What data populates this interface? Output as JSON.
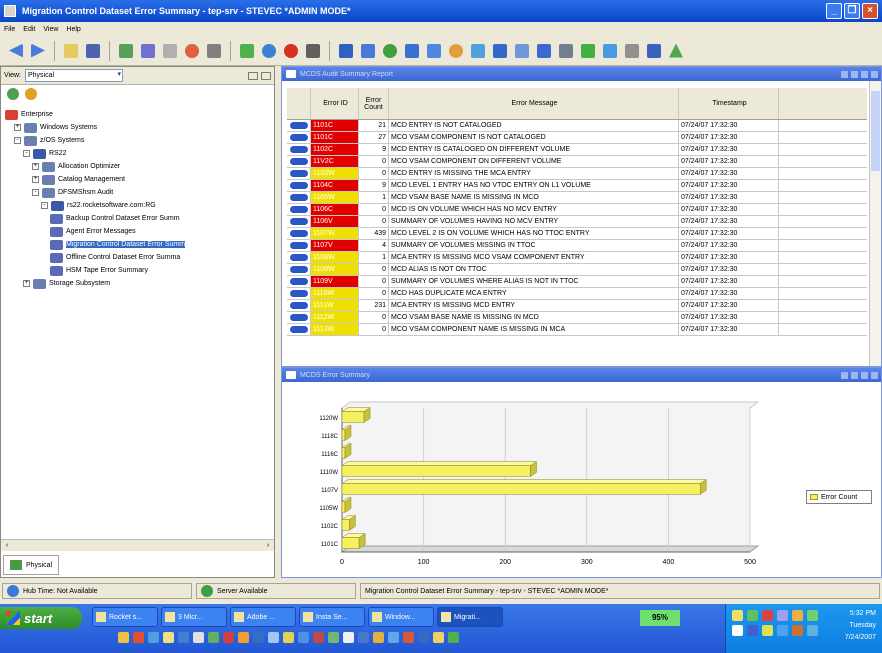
{
  "window": {
    "title": "Migration Control Dataset Error Summary - tep-srv - STEVEC   *ADMIN MODE*"
  },
  "menu": [
    "File",
    "Edit",
    "View",
    "Help"
  ],
  "left_pane": {
    "view_label": "View:",
    "view_value": "Physical",
    "tree": [
      {
        "label": "Enterprise",
        "level": 0,
        "expander": "",
        "icon": "enterprise"
      },
      {
        "label": "Windows Systems",
        "level": 1,
        "expander": "+",
        "icon": "folder"
      },
      {
        "label": "z/OS Systems",
        "level": 1,
        "expander": "-",
        "icon": "folder"
      },
      {
        "label": "RS22",
        "level": 2,
        "expander": "-",
        "icon": "system"
      },
      {
        "label": "Allocation Optimizer",
        "level": 3,
        "expander": "+",
        "icon": "folder"
      },
      {
        "label": "Catalog Management",
        "level": 3,
        "expander": "+",
        "icon": "folder"
      },
      {
        "label": "DFSMShsm Audit",
        "level": 3,
        "expander": "-",
        "icon": "folder"
      },
      {
        "label": "rs22.rocketsoftware.com:RG",
        "level": 4,
        "expander": "-",
        "icon": "system"
      },
      {
        "label": "Backup Control Dataset Error Summ",
        "level": 5,
        "expander": "",
        "icon": "report"
      },
      {
        "label": "Agent Error Messages",
        "level": 5,
        "expander": "",
        "icon": "report"
      },
      {
        "label": "Migration Control Dataset Error Summ",
        "level": 5,
        "expander": "",
        "icon": "report",
        "selected": true
      },
      {
        "label": "Offline Control Dataset Error Summa",
        "level": 5,
        "expander": "",
        "icon": "report"
      },
      {
        "label": "HSM Tape Error Summary",
        "level": 5,
        "expander": "",
        "icon": "report"
      },
      {
        "label": "Storage Subsystem",
        "level": 2,
        "expander": "+",
        "icon": "folder"
      }
    ],
    "tab_label": "Physical"
  },
  "report_panel": {
    "title": "MCDS Audit Summary Report",
    "columns": [
      "Error ID",
      "Error Count",
      "Error Message",
      "Timestamp"
    ],
    "rows": [
      {
        "id": "1101C",
        "count": "21",
        "message": "MCD ENTRY IS NOT CATALOGED",
        "ts": "07/24/07 17:32:30",
        "sev": "red"
      },
      {
        "id": "1101C",
        "count": "27",
        "message": "MCO VSAM COMPONENT IS NOT CATALOGED",
        "ts": "07/24/07 17:32:30",
        "sev": "red"
      },
      {
        "id": "1102C",
        "count": "9",
        "message": "MCD ENTRY IS CATALOGED ON DIFFERENT VOLUME",
        "ts": "07/24/07 17:32:30",
        "sev": "red"
      },
      {
        "id": "11V2C",
        "count": "0",
        "message": "MCO VSAM COMPONENT ON DIFFERENT VOLUME",
        "ts": "07/24/07 17:32:30",
        "sev": "red"
      },
      {
        "id": "1103W",
        "count": "0",
        "message": "MCD ENTRY IS MISSING THE MCA ENTRY",
        "ts": "07/24/07 17:32:30",
        "sev": "yellow"
      },
      {
        "id": "1104C",
        "count": "9",
        "message": "MCD LEVEL 1 ENTRY HAS NO VTOC ENTRY ON L1 VOLUME",
        "ts": "07/24/07 17:32:30",
        "sev": "red"
      },
      {
        "id": "1105W",
        "count": "1",
        "message": "MCD VSAM BASE NAME IS MISSING IN MCO",
        "ts": "07/24/07 17:32:30",
        "sev": "yellow"
      },
      {
        "id": "1106C",
        "count": "0",
        "message": "MCD IS ON VOLUME WHICH HAS NO MCV ENTRY",
        "ts": "07/24/07 17:32:30",
        "sev": "red"
      },
      {
        "id": "1106V",
        "count": "0",
        "message": "SUMMARY OF VOLUMES HAVING NO MCV ENTRY",
        "ts": "07/24/07 17:32:30",
        "sev": "red"
      },
      {
        "id": "1107W",
        "count": "439",
        "message": "MCD LEVEL 2 IS ON VOLUME WHICH HAS NO TTOC ENTRY",
        "ts": "07/24/07 17:32:30",
        "sev": "yellow"
      },
      {
        "id": "1107V",
        "count": "4",
        "message": "SUMMARY OF VOLUMES MISSING IN TTOC",
        "ts": "07/24/07 17:32:30",
        "sev": "red"
      },
      {
        "id": "1108W",
        "count": "1",
        "message": "MCA ENTRY IS MISSING MCO VSAM COMPONENT ENTRY",
        "ts": "07/24/07 17:32:30",
        "sev": "yellow"
      },
      {
        "id": "1109W",
        "count": "0",
        "message": "MCD ALIAS IS NOT ON TTOC",
        "ts": "07/24/07 17:32:30",
        "sev": "yellow"
      },
      {
        "id": "1109V",
        "count": "0",
        "message": "SUMMARY OF VOLUMES WHERE ALIAS IS NOT IN TTOC",
        "ts": "07/24/07 17:32:30",
        "sev": "red"
      },
      {
        "id": "1110W",
        "count": "0",
        "message": "MCD HAS DUPLICATE MCA ENTRY",
        "ts": "07/24/07 17:32:30",
        "sev": "yellow"
      },
      {
        "id": "1111W",
        "count": "231",
        "message": "MCA ENTRY IS MISSING MCD ENTRY",
        "ts": "07/24/07 17:32:30",
        "sev": "yellow"
      },
      {
        "id": "1112W",
        "count": "0",
        "message": "MCO VSAM BASE NAME IS MISSING IN MCD",
        "ts": "07/24/07 17:32:30",
        "sev": "yellow"
      },
      {
        "id": "1113W",
        "count": "0",
        "message": "MCO VSAM COMPONENT NAME IS MISSING IN MCA",
        "ts": "07/24/07 17:32:30",
        "sev": "yellow"
      }
    ]
  },
  "chart_panel": {
    "title": "MCDS Error Summary"
  },
  "chart_data": {
    "type": "bar",
    "orientation": "horizontal",
    "categories": [
      "1101C",
      "1102C",
      "1105W",
      "1107V",
      "1110W",
      "1116C",
      "1118C",
      "1120W"
    ],
    "series": [
      {
        "name": "Error Count",
        "values": [
          21,
          9,
          1,
          439,
          231,
          0,
          0,
          27
        ]
      }
    ],
    "xlim": [
      0,
      500
    ],
    "xticks": [
      0,
      100,
      200,
      300,
      400,
      500
    ],
    "grid": true,
    "legend": "right",
    "bar_color": "#f4f060"
  },
  "status": {
    "hub": "Hub Time: Not Available",
    "server": "Server Available",
    "workspace": "Migration Control Dataset Error Summary - tep-srv - STEVEC   *ADMIN MODE*"
  },
  "taskbar": {
    "start": "start",
    "tasks": [
      "Rocket s...",
      "3 Micr...",
      "Adobe ...",
      "Insta Se...",
      "Window...",
      "Migrati..."
    ],
    "battery_pct": "95%",
    "clock": [
      "5:32 PM",
      "Tuesday",
      "7/24/2007"
    ]
  },
  "colors": {
    "error_red": "#e00000",
    "warning_yellow": "#f0e000",
    "title_blue": "#0a46c8",
    "panel_blue": "#4a78e0"
  }
}
